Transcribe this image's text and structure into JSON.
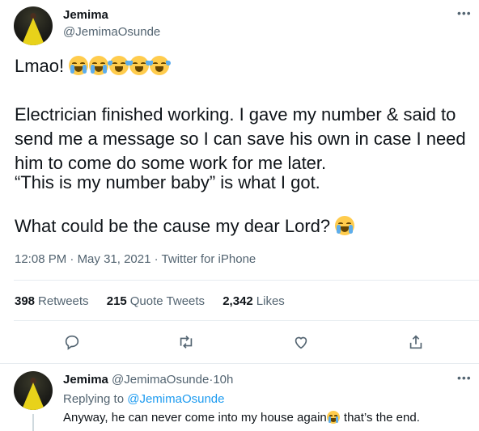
{
  "tweet": {
    "author_name": "Jemima",
    "author_handle": "@JemimaOsunde",
    "more_label": "•••",
    "line1_text": "Lmao!",
    "line1_emojis": [
      "loudly-crying-face",
      "loudly-crying-face",
      "face-with-tears-of-joy",
      "face-with-tears-of-joy",
      "face-with-tears-of-joy"
    ],
    "paragraph2": "Electrician finished working. I gave my number & said to send me a message so I can save his own in case I need him to come do some work for me later.",
    "paragraph3": "“This is my number baby” is what I got.",
    "paragraph4": "What could be the cause my dear Lord?",
    "paragraph4_emoji": "loudly-crying-face",
    "time": "12:08 PM",
    "separator": "·",
    "date": "May 31, 2021",
    "source": "Twitter for iPhone"
  },
  "stats": {
    "retweets_count": "398",
    "retweets_label": "Retweets",
    "quote_count": "215",
    "quote_label": "Quote Tweets",
    "likes_count": "2,342",
    "likes_label": "Likes"
  },
  "actions": [
    "reply-icon",
    "retweet-icon",
    "like-icon",
    "share-icon"
  ],
  "reply": {
    "author_name": "Jemima",
    "author_handle": "@JemimaOsunde",
    "dot": "·",
    "age": "10h",
    "more_label": "•••",
    "replying_prefix": "Replying to",
    "replying_mention": "@JemimaOsunde",
    "text_before": "Anyway, he can never come into my house again",
    "text_emoji": "loudly-crying-face",
    "text_after": " that’s the end."
  },
  "colors": {
    "text": "#0f1419",
    "secondary": "#536471",
    "link": "#1d9bf0",
    "divider": "#e6ecf0",
    "avatar_dress": "#e8d21a"
  }
}
